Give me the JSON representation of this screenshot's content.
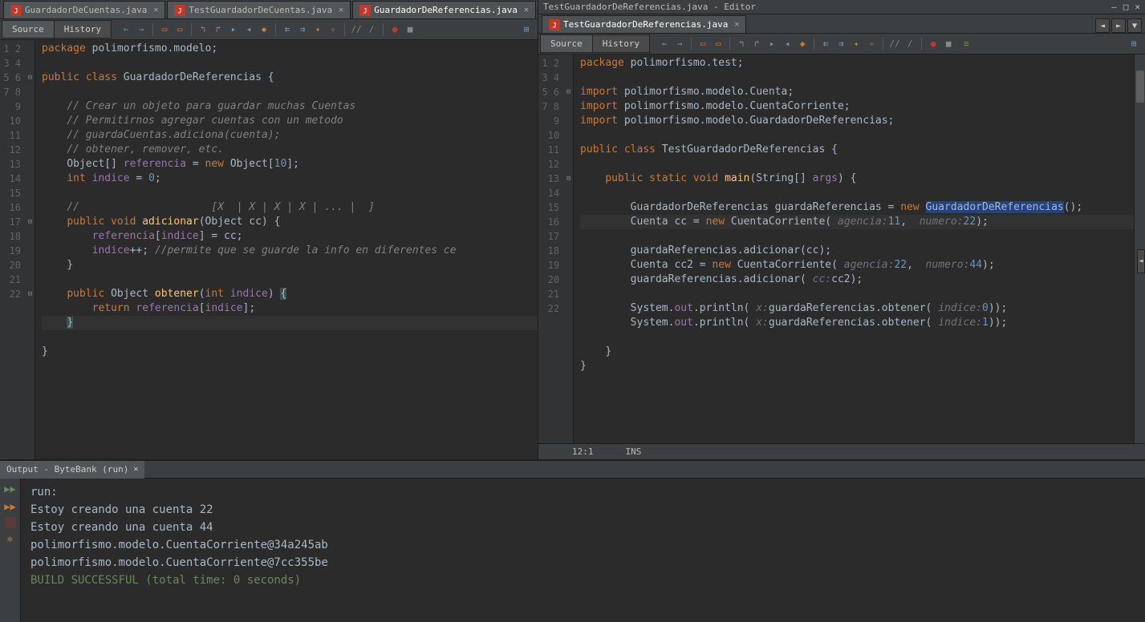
{
  "right_window_title": "TestGuardadorDeReferencias.java - Editor",
  "tabs_left": [
    {
      "label": "GuardadorDeCuentas.java",
      "active": false
    },
    {
      "label": "TestGuardadorDeCuentas.java",
      "active": false
    },
    {
      "label": "GuardadorDeReferencias.java",
      "active": true
    }
  ],
  "tabs_right": [
    {
      "label": "TestGuardadorDeReferencias.java",
      "active": true
    }
  ],
  "source_btn": "Source",
  "history_btn": "History",
  "status": {
    "pos": "12:1",
    "mode": "INS"
  },
  "output": {
    "title": "Output - ByteBank (run)",
    "lines": [
      {
        "text": "run:",
        "cls": ""
      },
      {
        "text": "Estoy creando una cuenta 22",
        "cls": ""
      },
      {
        "text": "Estoy creando una cuenta 44",
        "cls": ""
      },
      {
        "text": "polimorfismo.modelo.CuentaCorriente@34a245ab",
        "cls": ""
      },
      {
        "text": "polimorfismo.modelo.CuentaCorriente@7cc355be",
        "cls": ""
      },
      {
        "text": "BUILD SUCCESSFUL (total time: 0 seconds)",
        "cls": "out-success"
      }
    ]
  },
  "left_code_lines": 22,
  "right_code_lines": 22
}
